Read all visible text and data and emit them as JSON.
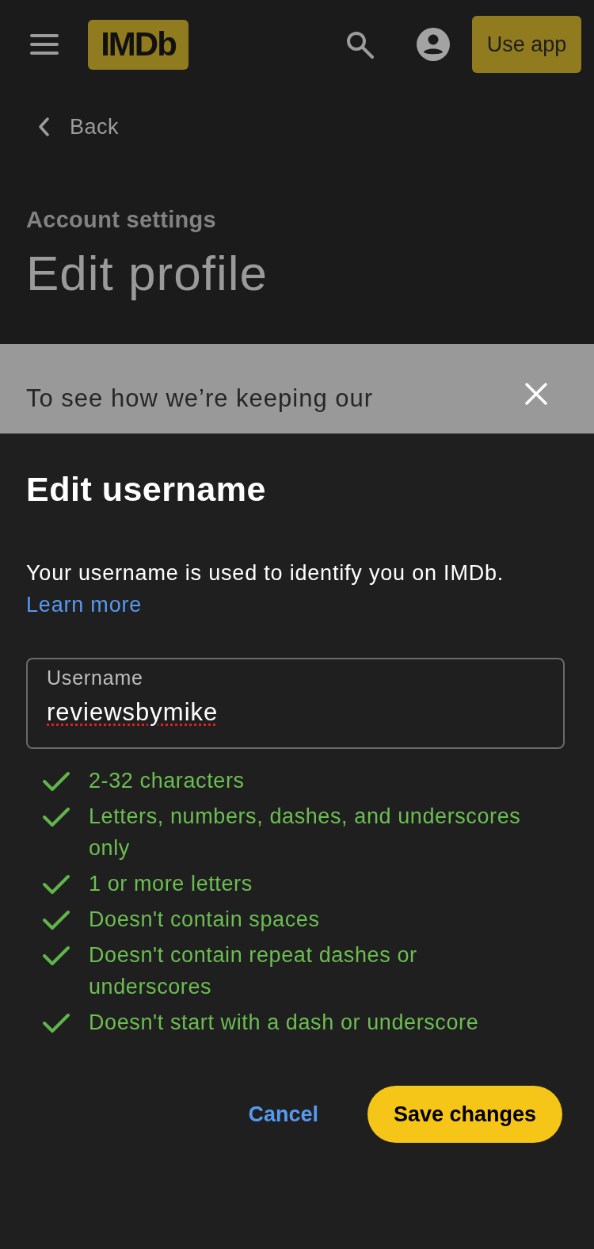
{
  "header": {
    "logo": "IMDb",
    "app_button": "Use app"
  },
  "back_link": {
    "label": "Back"
  },
  "page": {
    "eyebrow": "Account settings",
    "title": "Edit profile"
  },
  "banner": {
    "text": "To see how we’re keeping our"
  },
  "dialog": {
    "title": "Edit username",
    "description": "Your username is used to identify you on IMDb.",
    "link": "Learn more",
    "field": {
      "label": "Username",
      "value": "reviewsbymike",
      "misspelled": true
    },
    "rules": [
      {
        "text": "2-32 characters",
        "met": true
      },
      {
        "text": "Letters, numbers, dashes, and underscores only",
        "met": true
      },
      {
        "text": "1 or more letters",
        "met": true
      },
      {
        "text": "Doesn't contain spaces",
        "met": true
      },
      {
        "text": "Doesn't contain repeat dashes or underscores",
        "met": true
      },
      {
        "text": "Doesn't start with a dash or underscore",
        "met": true
      }
    ],
    "buttons": [
      {
        "label": "Cancel",
        "kind": "text"
      },
      {
        "label": "Save changes",
        "kind": "primary"
      }
    ]
  }
}
